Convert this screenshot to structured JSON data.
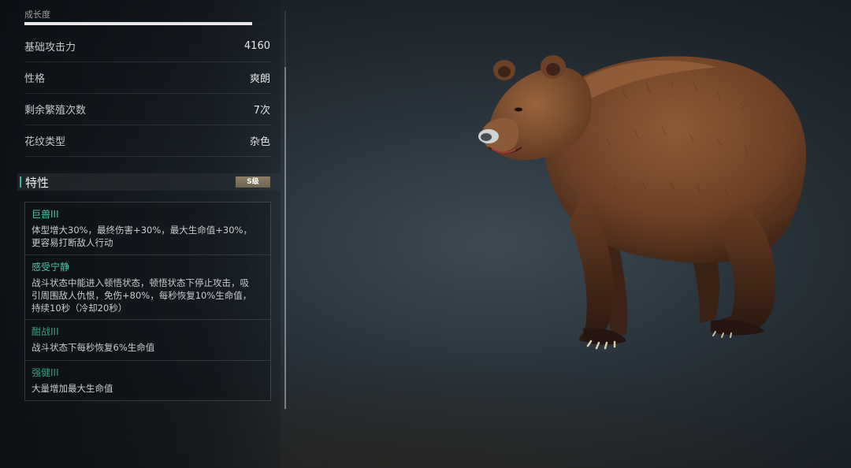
{
  "growth": {
    "label": "成长度",
    "progress": 0.93
  },
  "stats": [
    {
      "label": "基础攻击力",
      "value": "4160"
    },
    {
      "label": "性格",
      "value": "爽朗"
    },
    {
      "label": "剩余繁殖次数",
      "value": "7次"
    },
    {
      "label": "花纹类型",
      "value": "杂色"
    }
  ],
  "traits": {
    "title": "特性",
    "grade": "S级",
    "items": [
      {
        "name": "巨兽III",
        "desc": "体型增大30%，最终伤害+30%，最大生命值+30%，\n更容易打断敌人行动"
      },
      {
        "name": "感受宁静",
        "desc": "战斗状态中能进入顿悟状态，顿悟状态下停止攻击，吸\n引周围敌人仇恨，免伤+80%，每秒恢复10%生命值，\n持续10秒（冷却20秒）"
      },
      {
        "name": "酣战III",
        "desc": "战斗状态下每秒恢复6%生命值"
      },
      {
        "name": "强健III",
        "desc": "大量增加最大生命值"
      }
    ]
  },
  "colors": {
    "trait_name": "#4cc7a5",
    "accent": "#3fb19a",
    "badge": "#8d7f64",
    "bear_fur": "#7a4a2c"
  },
  "icons": {
    "creature": "brown-bear-icon"
  }
}
